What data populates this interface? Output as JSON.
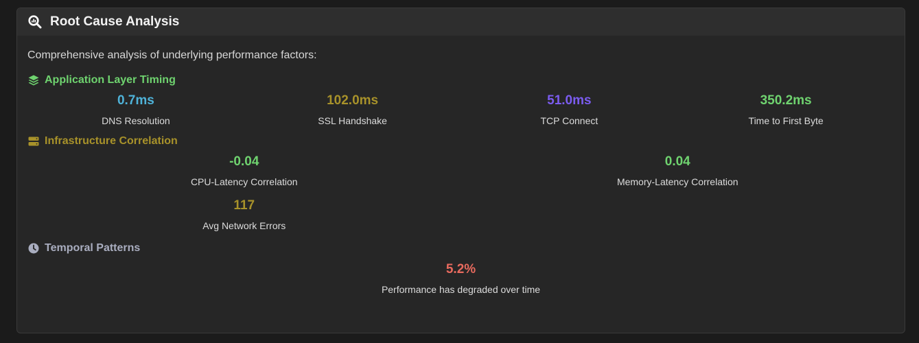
{
  "header": {
    "title": "Root Cause Analysis",
    "icon": "magnifier-chart-icon"
  },
  "intro": "Comprehensive analysis of underlying performance factors:",
  "sections": {
    "app": {
      "title": "Application Layer Timing",
      "icon": "layers-icon",
      "color": "#6fd36f",
      "metrics": [
        {
          "value": "0.7ms",
          "label": "DNS Resolution",
          "color": "#4fb3d9"
        },
        {
          "value": "102.0ms",
          "label": "SSL Handshake",
          "color": "#a8922a"
        },
        {
          "value": "51.0ms",
          "label": "TCP Connect",
          "color": "#7b5cf0"
        },
        {
          "value": "350.2ms",
          "label": "Time to First Byte",
          "color": "#6fd36f"
        }
      ]
    },
    "infra": {
      "title": "Infrastructure Correlation",
      "icon": "server-icon",
      "color": "#a8922a",
      "metrics": [
        {
          "value": "-0.04",
          "label": "CPU-Latency Correlation",
          "color": "#6fd36f"
        },
        {
          "value": "0.04",
          "label": "Memory-Latency Correlation",
          "color": "#6fd36f"
        },
        {
          "value": "117",
          "label": "Avg Network Errors",
          "color": "#a8922a"
        }
      ]
    },
    "temporal": {
      "title": "Temporal Patterns",
      "icon": "clock-icon",
      "color": "#a9adbf",
      "metrics": [
        {
          "value": "5.2%",
          "label": "Performance has degraded over time",
          "color": "#e86a5e"
        }
      ]
    }
  }
}
